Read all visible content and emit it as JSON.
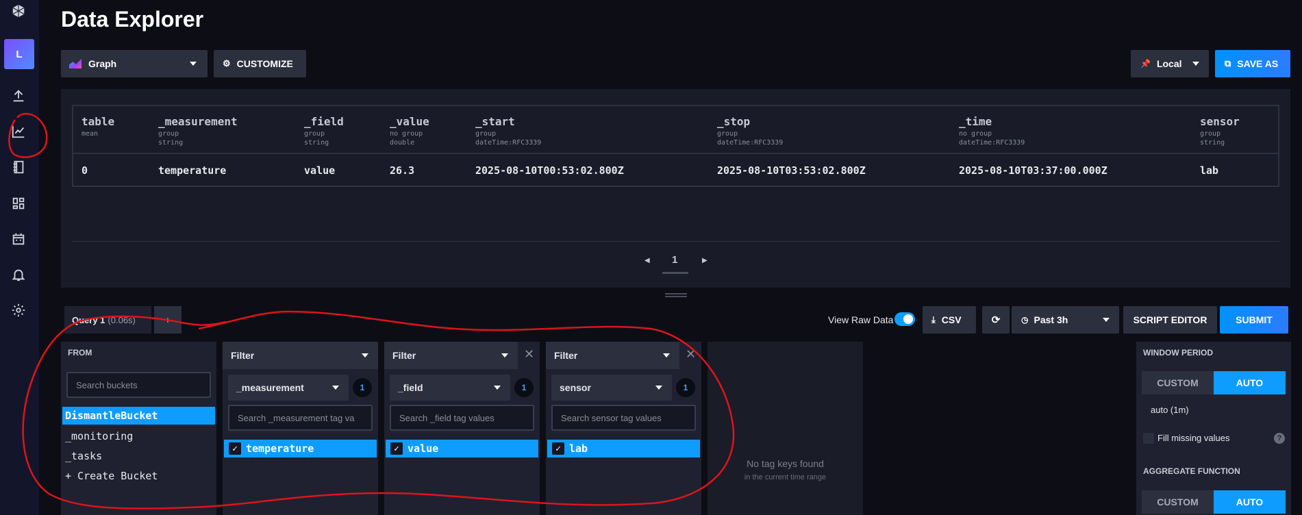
{
  "page": {
    "title": "Data Explorer"
  },
  "sidebar": {
    "org_initial": "L"
  },
  "toolbar": {
    "vis_type": "Graph",
    "customize_label": "CUSTOMIZE",
    "timezone": "Local",
    "save_as_label": "SAVE AS"
  },
  "results": {
    "columns": [
      {
        "name": "table",
        "sub1": "mean",
        "sub2": ""
      },
      {
        "name": "_measurement",
        "sub1": "group",
        "sub2": "string"
      },
      {
        "name": "_field",
        "sub1": "group",
        "sub2": "string"
      },
      {
        "name": "_value",
        "sub1": "no group",
        "sub2": "double"
      },
      {
        "name": "_start",
        "sub1": "group",
        "sub2": "dateTime:RFC3339"
      },
      {
        "name": "_stop",
        "sub1": "group",
        "sub2": "dateTime:RFC3339"
      },
      {
        "name": "_time",
        "sub1": "no group",
        "sub2": "dateTime:RFC3339"
      },
      {
        "name": "sensor",
        "sub1": "group",
        "sub2": "string"
      }
    ],
    "row": [
      "0",
      "temperature",
      "value",
      "26.3",
      "2025-08-10T00:53:02.800Z",
      "2025-08-10T03:53:02.800Z",
      "2025-08-10T03:37:00.000Z",
      "lab"
    ],
    "page": "1"
  },
  "query": {
    "tab_label": "Query 1",
    "tab_time": "(0.06s)",
    "add_label": "+",
    "view_raw_label": "View Raw Data",
    "view_raw_on": true,
    "csv_label": "CSV",
    "time_range": "Past 3h",
    "script_editor_label": "SCRIPT EDITOR",
    "submit_label": "SUBMIT"
  },
  "from": {
    "label": "FROM",
    "search_placeholder": "Search buckets",
    "buckets": [
      "DismantleBucket",
      "_monitoring",
      "_tasks",
      "+ Create Bucket"
    ],
    "selected": 0
  },
  "filters": [
    {
      "header": "Filter",
      "key": "_measurement",
      "count": "1",
      "search_placeholder": "Search _measurement tag va",
      "value": "temperature",
      "closable": false
    },
    {
      "header": "Filter",
      "key": "_field",
      "count": "1",
      "search_placeholder": "Search _field tag values",
      "value": "value",
      "closable": true
    },
    {
      "header": "Filter",
      "key": "sensor",
      "count": "1",
      "search_placeholder": "Search sensor tag values",
      "value": "lab",
      "closable": true
    }
  ],
  "empty_card": {
    "title": "No tag keys found",
    "subtitle": "in the current time range"
  },
  "aggregate": {
    "window_period_label": "WINDOW PERIOD",
    "custom_label": "CUSTOM",
    "auto_label": "AUTO",
    "window_value": "auto (1m)",
    "fill_missing_label": "Fill missing values",
    "help_label": "?",
    "function_label": "AGGREGATE FUNCTION"
  },
  "colors": {
    "accent": "#0e9dff",
    "annotation": "#e0131b"
  }
}
